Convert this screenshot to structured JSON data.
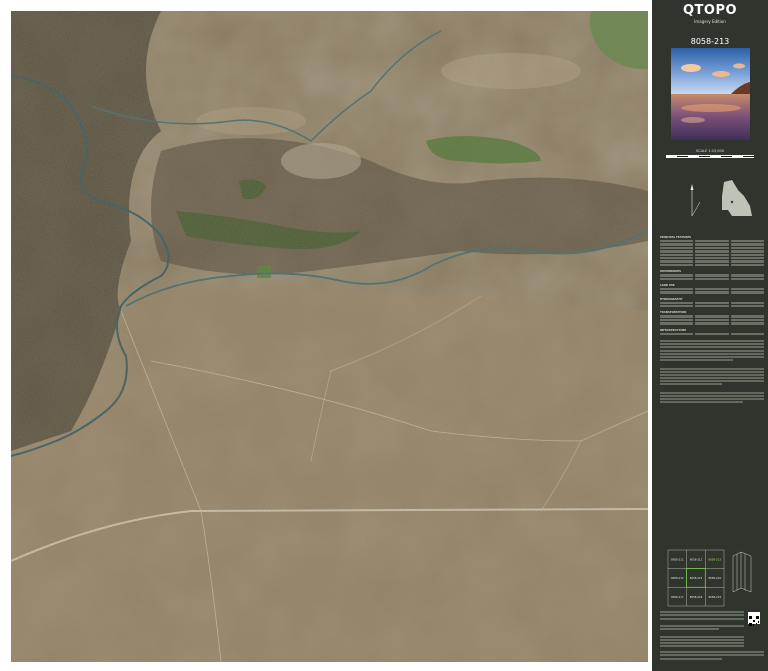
{
  "panel": {
    "title": "QTOPO",
    "subtitle": "Imagery Edition",
    "sheet_number": "8058-213",
    "scale": "SCALE 1:15,000"
  },
  "colors": {
    "panel_background": "#2f352c",
    "sheet_background": "#ffffff",
    "imagery_base": "#8a7a5e",
    "vegetation": "#3f5a2c",
    "river": "#3f6c74",
    "track": "#d9cfb8"
  },
  "legend": {
    "headings": [
      "PRINCIPAL FEATURES",
      "WATERBODIES",
      "LAND USE",
      "HYDROGRAPHY",
      "TRANSPORTATION",
      "INFRASTRUCTURE"
    ]
  },
  "index_map": {
    "sheets": [
      "8058-211",
      "8058-212",
      "8058-213",
      "8058-214",
      "8058-215",
      "8058-216",
      "8058-217",
      "8058-218",
      "8058-219"
    ],
    "selected": "8058-213"
  },
  "icons": [
    "queensland-state-icon",
    "north-arrow-icon",
    "qr-code-icon",
    "scale-bar-icon"
  ]
}
